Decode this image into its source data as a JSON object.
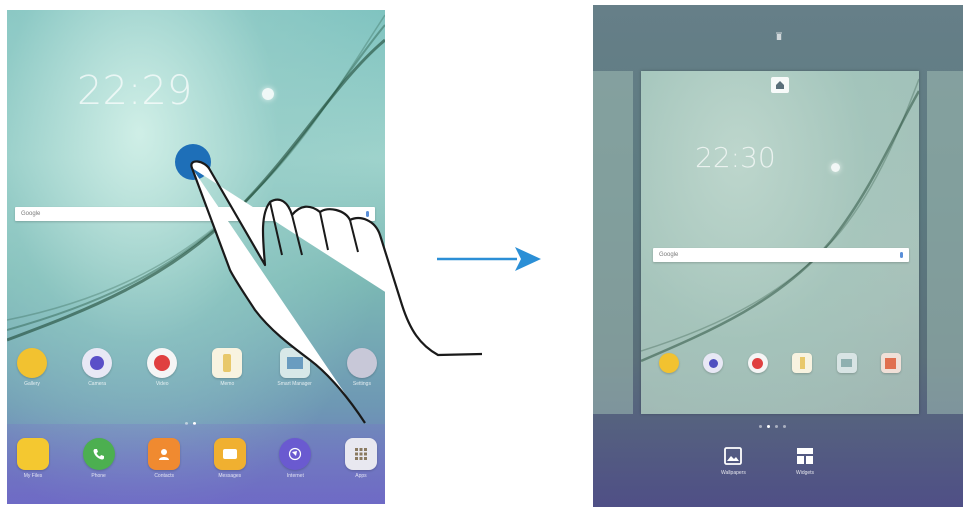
{
  "left_screen": {
    "clock": {
      "time": "22:29"
    },
    "search": {
      "brand": "Google"
    },
    "apps": [
      {
        "label": "Gallery",
        "color": "#f2c230",
        "icon": "gallery-icon"
      },
      {
        "label": "Camera",
        "color": "#6f6fd0",
        "icon": "camera-icon"
      },
      {
        "label": "Video",
        "color": "#e04040",
        "icon": "video-icon"
      },
      {
        "label": "Memo",
        "color": "#f0d070",
        "icon": "memo-icon"
      },
      {
        "label": "Smart Manager",
        "color": "#7fb0b0",
        "icon": "smart-manager-icon"
      },
      {
        "label": "Settings",
        "color": "#b0b0c0",
        "icon": "settings-icon"
      }
    ],
    "dock": [
      {
        "label": "My Files",
        "color": "#f4c830",
        "icon": "folder-icon"
      },
      {
        "label": "Phone",
        "color": "#4caf50",
        "icon": "phone-icon"
      },
      {
        "label": "Contacts",
        "color": "#f08a30",
        "icon": "contacts-icon"
      },
      {
        "label": "Messages",
        "color": "#f0b030",
        "icon": "messages-icon"
      },
      {
        "label": "Internet",
        "color": "#6a5ad0",
        "icon": "internet-icon"
      },
      {
        "label": "Apps",
        "color": "#e8e8f0",
        "icon": "apps-grid-icon"
      }
    ]
  },
  "right_screen": {
    "clock": {
      "time": "22:30"
    },
    "search": {
      "brand": "Google"
    },
    "apps": [
      {
        "color": "#f2c230"
      },
      {
        "color": "#5050c0"
      },
      {
        "color": "#e04040"
      },
      {
        "color": "#f0d070"
      },
      {
        "color": "#8fb0b0"
      },
      {
        "color": "#e07050"
      }
    ],
    "options": [
      {
        "label": "Wallpapers",
        "icon": "wallpapers-icon"
      },
      {
        "label": "Widgets",
        "icon": "widgets-icon"
      }
    ]
  },
  "colors": {
    "arrow": "#2b8fd6",
    "touch": "#1e6fb8"
  }
}
